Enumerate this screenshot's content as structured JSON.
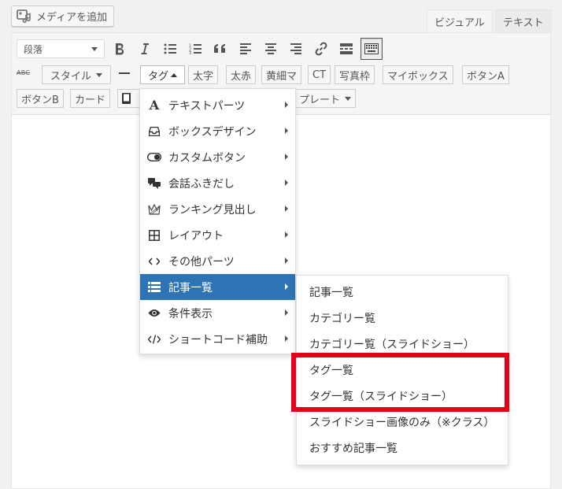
{
  "media_button": {
    "label": "メディアを追加",
    "icon": "media-icon"
  },
  "tabs": [
    {
      "label": "ビジュアル",
      "active": true
    },
    {
      "label": "テキスト",
      "active": false
    }
  ],
  "toolbar": {
    "format_select": "段落",
    "row1_icons": [
      "bold-icon",
      "italic-icon",
      "bullet-list-icon",
      "numbered-list-icon",
      "blockquote-icon",
      "align-left-icon",
      "align-center-icon",
      "align-right-icon",
      "link-icon",
      "more-tag-icon",
      "toolbar-toggle-icon"
    ],
    "strike_label": "ABC",
    "style_button": "スタイル",
    "tag_button": "タグ",
    "buttons_row2": [
      "太字",
      "太赤",
      "黄細マ",
      "CT",
      "写真枠",
      "マイボックス",
      "ボタンA"
    ],
    "buttons_row3": [
      "ボタンB",
      "カード"
    ],
    "template_button": "プレート"
  },
  "main_menu": [
    {
      "label": "テキストパーツ",
      "icon": "font-icon",
      "submenu": true,
      "active": false
    },
    {
      "label": "ボックスデザイン",
      "icon": "inbox-icon",
      "submenu": true,
      "active": false
    },
    {
      "label": "カスタムボタン",
      "icon": "toggle-icon",
      "submenu": true,
      "active": false
    },
    {
      "label": "会話ふきだし",
      "icon": "comments-icon",
      "submenu": true,
      "active": false
    },
    {
      "label": "ランキング見出し",
      "icon": "crown-icon",
      "submenu": true,
      "active": false
    },
    {
      "label": "レイアウト",
      "icon": "grid-icon",
      "submenu": true,
      "active": false
    },
    {
      "label": "その他パーツ",
      "icon": "code-icon",
      "submenu": true,
      "active": false
    },
    {
      "label": "記事一覧",
      "icon": "list-icon",
      "submenu": true,
      "active": true
    },
    {
      "label": "条件表示",
      "icon": "eye-icon",
      "submenu": true,
      "active": false
    },
    {
      "label": "ショートコード補助",
      "icon": "shortcode-icon",
      "submenu": true,
      "active": false
    }
  ],
  "sub_menu": [
    "記事一覧",
    "カテゴリー覧",
    "カテゴリー覧（スライドショー）",
    "タグ一覧",
    "タグ一覧（スライドショー）",
    "スライドショー画像のみ（※クラス）",
    "おすすめ記事一覧"
  ],
  "highlight_color": "#e5001a",
  "active_color": "#2e74b5"
}
